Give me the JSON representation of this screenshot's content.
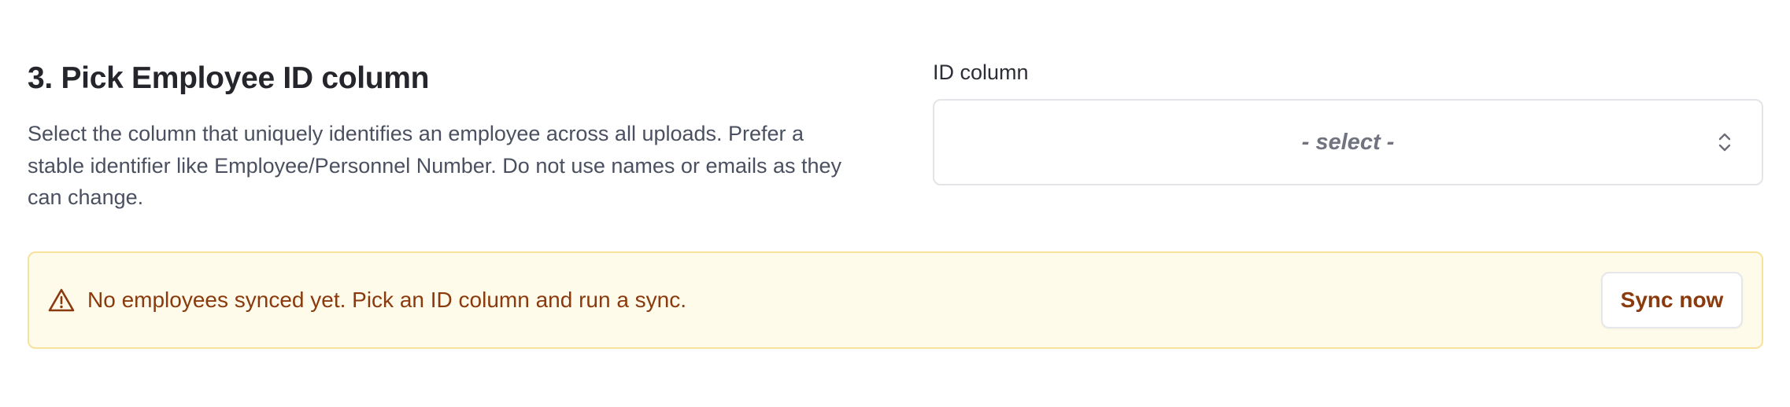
{
  "step": {
    "title": "3. Pick Employee ID column",
    "description": "Select the column that uniquely identifies an employee across all uploads. Prefer a stable identifier like Employee/Personnel Number. Do not use names or emails as they can change."
  },
  "id_field": {
    "label": "ID column",
    "selected_value": "- select -",
    "icon": "chevron-up-down-icon"
  },
  "alert": {
    "icon": "warning-triangle-icon",
    "message": "No employees synced yet. Pick an ID column and run a sync.",
    "action_label": "Sync now"
  },
  "colors": {
    "alert_background": "#fefbeb",
    "alert_border": "#f6e29a",
    "alert_text": "#8a3a0c",
    "select_border": "#e3e4e8"
  }
}
